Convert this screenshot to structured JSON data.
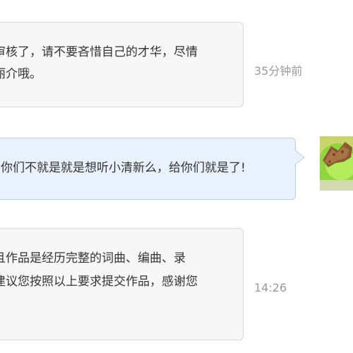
{
  "messages": [
    {
      "side": "left",
      "lines": [
        "审核了，请不要吝惜自己的才华，尽情",
        "丽介哦。"
      ],
      "time": "35分钟前"
    },
    {
      "side": "right",
      "lines": [
        "你们不就是就是想听小清新么，给你们就是了!"
      ],
      "avatar": "food-photo-avatar"
    },
    {
      "side": "left",
      "lines": [
        "且作品是经历完整的词曲、编曲、录",
        "建议您按照以上要求提交作品，感谢您"
      ],
      "time": "14:26"
    }
  ],
  "colors": {
    "left_bubble_bg": "#f7f7f7",
    "left_bubble_border": "#d9d9d9",
    "right_bubble_bg": "#e9f1fc",
    "right_bubble_border": "#b9d0ee",
    "text": "#333333",
    "timestamp": "#9a9a9a"
  }
}
